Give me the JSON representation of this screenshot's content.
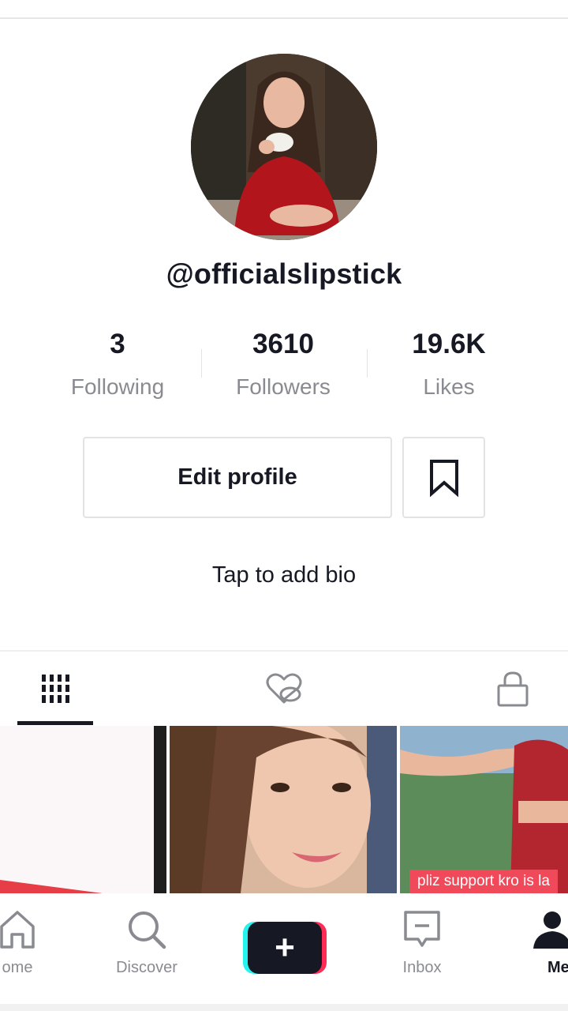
{
  "profile": {
    "username": "@officialslipstick",
    "bio_placeholder": "Tap to add bio"
  },
  "stats": [
    {
      "value": "3",
      "label": "Following"
    },
    {
      "value": "3610",
      "label": "Followers"
    },
    {
      "value": "19.6K",
      "label": "Likes"
    }
  ],
  "actions": {
    "edit_profile_label": "Edit profile",
    "bookmark_icon": "bookmark-icon"
  },
  "tabs": [
    {
      "name": "videos",
      "icon": "grid-columns-icon",
      "active": true
    },
    {
      "name": "liked",
      "icon": "hidden-heart-icon",
      "active": false
    },
    {
      "name": "private",
      "icon": "lock-icon",
      "active": false
    }
  ],
  "videos": [
    {
      "caption": ""
    },
    {
      "caption": ""
    },
    {
      "caption": "pliz support kro is la"
    }
  ],
  "bottom_nav": [
    {
      "label": "ome",
      "icon": "home-icon",
      "active": false
    },
    {
      "label": "Discover",
      "icon": "search-icon",
      "active": false
    },
    {
      "label": "",
      "icon": "plus-icon",
      "active": false
    },
    {
      "label": "Inbox",
      "icon": "inbox-icon",
      "active": false
    },
    {
      "label": "Me",
      "icon": "person-icon",
      "active": true
    }
  ],
  "colors": {
    "text_primary": "#161823",
    "text_secondary": "#8a8b91",
    "brand_cyan": "#25f4ee",
    "brand_pink": "#fe2c55",
    "caption_bg": "#f04a5a"
  }
}
